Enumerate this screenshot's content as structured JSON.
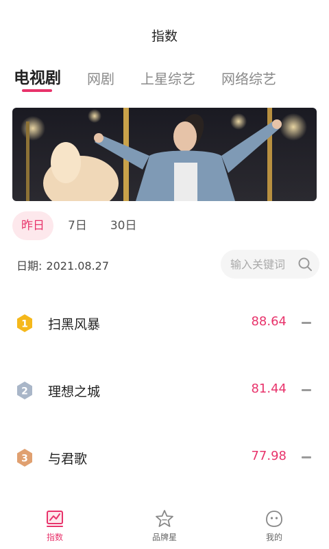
{
  "header": {
    "title": "指数"
  },
  "category_tabs": [
    {
      "label": "电视剧",
      "active": true
    },
    {
      "label": "网剧",
      "active": false
    },
    {
      "label": "上星综艺",
      "active": false
    },
    {
      "label": "网络综艺",
      "active": false
    }
  ],
  "banner": {
    "image": "banner-photo"
  },
  "period_filters": [
    {
      "label": "昨日",
      "active": true
    },
    {
      "label": "7日",
      "active": false
    },
    {
      "label": "30日",
      "active": false
    }
  ],
  "date": {
    "label": "日期:",
    "value": "2021.08.27"
  },
  "search": {
    "placeholder": "输入关键词"
  },
  "ranking": [
    {
      "rank": "1",
      "name": "扫黑风暴",
      "score": "88.64",
      "trend": "flat"
    },
    {
      "rank": "2",
      "name": "理想之城",
      "score": "81.44",
      "trend": "flat"
    },
    {
      "rank": "3",
      "name": "与君歌",
      "score": "77.98",
      "trend": "flat"
    }
  ],
  "bottom_nav": [
    {
      "label": "指数",
      "icon": "chart-icon",
      "active": true
    },
    {
      "label": "品牌星",
      "icon": "star-icon",
      "active": false
    },
    {
      "label": "我的",
      "icon": "profile-icon",
      "active": false
    }
  ],
  "colors": {
    "accent": "#e8336b",
    "gold": "#f5b81b",
    "silver": "#a9b6c8",
    "bronze": "#e0a070"
  }
}
